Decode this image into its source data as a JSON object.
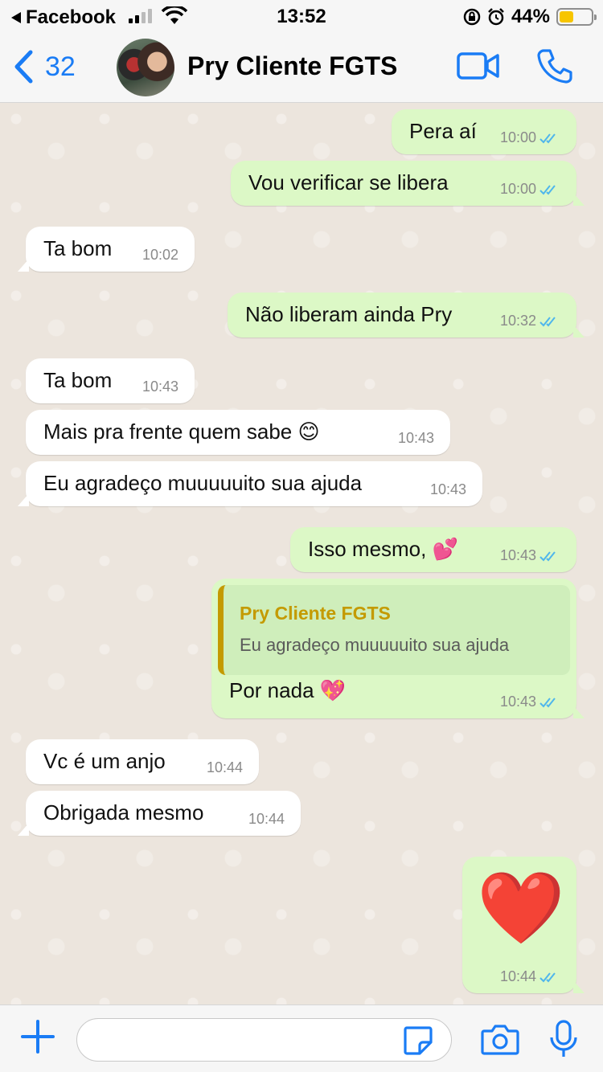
{
  "status_bar": {
    "back_app": "Facebook",
    "time": "13:52",
    "battery": "44%",
    "battery_level": 0.44
  },
  "header": {
    "back_count": "32",
    "contact_name": "Pry Cliente FGTS"
  },
  "messages": [
    {
      "dir": "out",
      "text": "Pera aí",
      "time": "10:00",
      "read": true
    },
    {
      "dir": "out",
      "text": "Vou verificar se libera",
      "time": "10:00",
      "read": true
    },
    {
      "dir": "in",
      "text": "Ta bom",
      "time": "10:02"
    },
    {
      "dir": "out",
      "text": "Não liberam ainda Pry",
      "time": "10:32",
      "read": true
    },
    {
      "dir": "in",
      "text": "Ta bom",
      "time": "10:43"
    },
    {
      "dir": "in",
      "text": "Mais pra frente quem sabe 😊",
      "time": "10:43"
    },
    {
      "dir": "in",
      "text": "Eu agradeço muuuuuito sua ajuda",
      "time": "10:43"
    },
    {
      "dir": "out",
      "text": "Isso mesmo, 💕",
      "time": "10:43",
      "read": true
    },
    {
      "dir": "out",
      "text": "Por nada 💖",
      "time": "10:43",
      "read": true,
      "reply_to": {
        "name": "Pry Cliente FGTS",
        "text": "Eu agradeço muuuuuito sua ajuda"
      }
    },
    {
      "dir": "in",
      "text": "Vc é  um anjo",
      "time": "10:44"
    },
    {
      "dir": "in",
      "text": "Obrigada mesmo",
      "time": "10:44"
    },
    {
      "dir": "out",
      "text": "❤️",
      "time": "10:44",
      "read": true
    }
  ],
  "colors": {
    "accent": "#1a7cf5",
    "outgoing_bubble": "#dcf8c6",
    "incoming_bubble": "#ffffff",
    "chat_background": "#ece5dd",
    "read_ticks": "#4fb6ec",
    "quote_name": "#c49a00"
  },
  "icons": {
    "back": "chevron-left-icon",
    "video": "video-camera-icon",
    "call": "phone-icon",
    "attach": "plus-icon",
    "sticker": "sticker-icon",
    "camera": "camera-icon",
    "mic": "microphone-icon"
  }
}
